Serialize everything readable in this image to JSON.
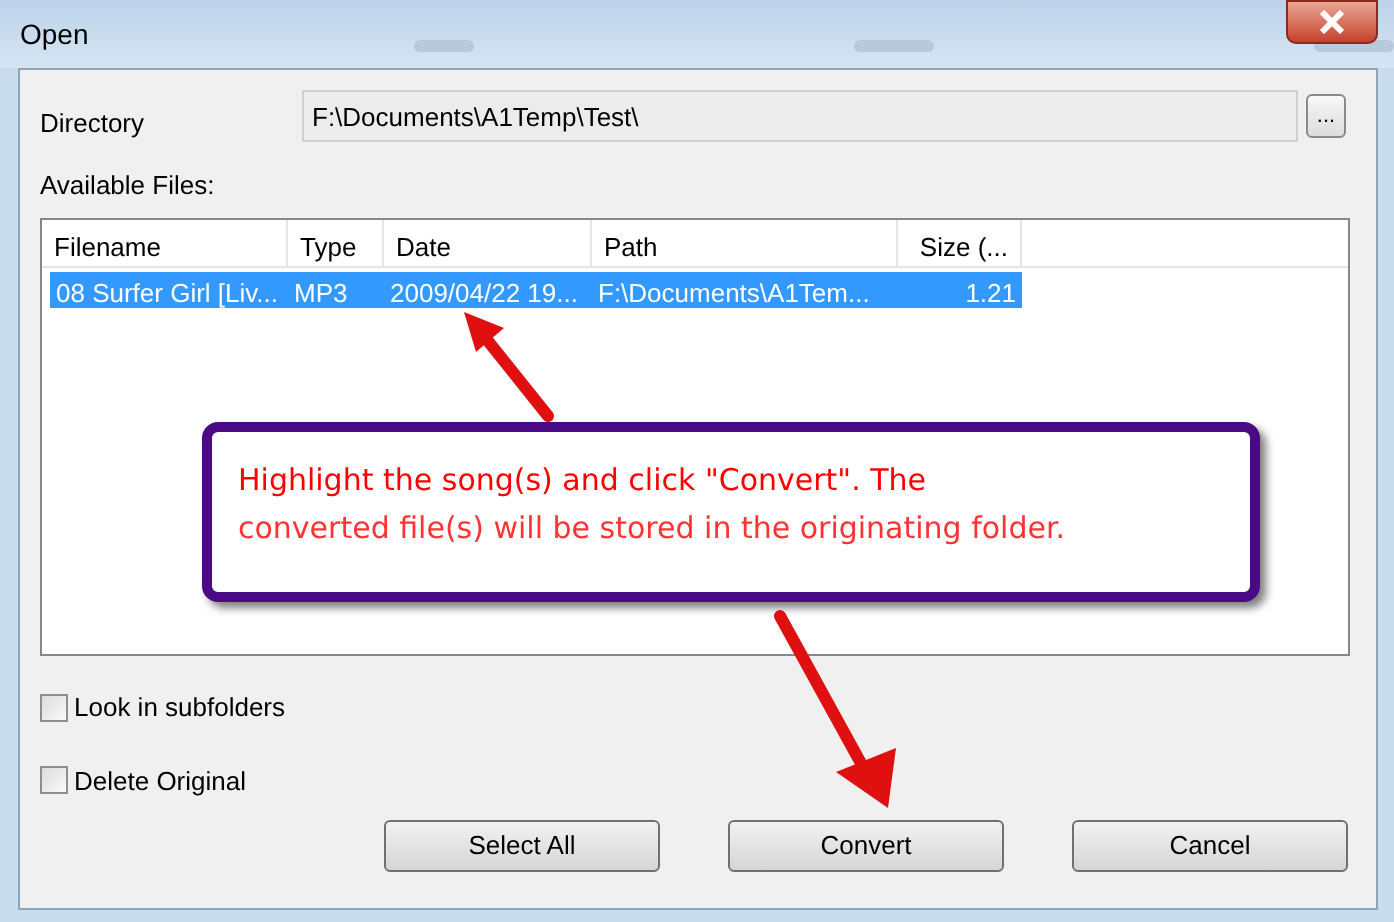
{
  "window": {
    "title": "Open"
  },
  "directory": {
    "label": "Directory",
    "value": "F:\\Documents\\A1Temp\\Test\\",
    "browse_button": "..."
  },
  "files_label": "Available Files:",
  "table": {
    "columns": [
      "Filename",
      "Type",
      "Date",
      "Path",
      "Size (..."
    ],
    "rows": [
      {
        "cells": [
          "08 Surfer Girl [Liv...",
          "MP3",
          "2009/04/22 19...",
          "F:\\Documents\\A1Tem...",
          "1.21"
        ],
        "selected": true
      }
    ]
  },
  "options": [
    {
      "label": "Look in subfolders",
      "checked": false
    },
    {
      "label": "Delete Original",
      "checked": false
    }
  ],
  "buttons": [
    "Select All",
    "Convert",
    "Cancel"
  ],
  "annotation": {
    "lines": [
      "Highlight the song(s) and click \"Convert\". The",
      "converted file(s) will be stored in the originating folder."
    ]
  }
}
